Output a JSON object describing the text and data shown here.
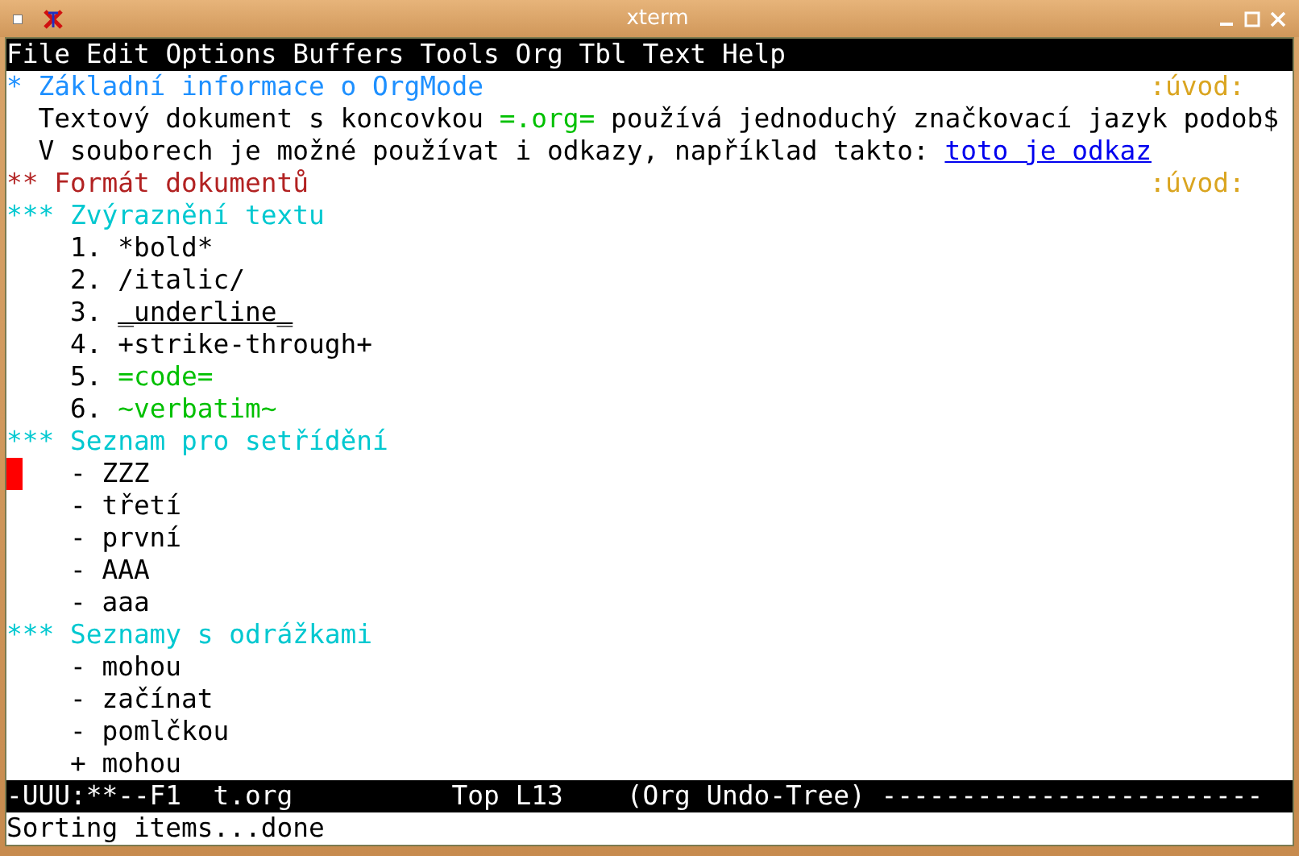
{
  "window": {
    "title": "xterm"
  },
  "menu": [
    "File",
    "Edit",
    "Options",
    "Buffers",
    "Tools",
    "Org",
    "Tbl",
    "Text",
    "Help"
  ],
  "lines": [
    {
      "kind": "h1",
      "cursor": false,
      "parts": [
        {
          "kind": "plain",
          "text": "* Základní informace o OrgMode"
        }
      ],
      "tag": ":úvod:"
    },
    {
      "kind": "body",
      "cursor": false,
      "parts": [
        {
          "kind": "plain",
          "text": "Textový dokument s koncovkou"
        },
        {
          "kind": "code",
          "text": "=.org="
        },
        {
          "kind": "plain",
          "text": "používá jednoduchý značkovací jazyk podob$"
        }
      ]
    },
    {
      "kind": "body",
      "cursor": false,
      "parts": [
        {
          "kind": "plain",
          "text": "V souborech je možné používat i odkazy, například takto:"
        },
        {
          "kind": "link",
          "text": "toto je odkaz"
        }
      ]
    },
    {
      "kind": "h2",
      "cursor": false,
      "parts": [
        {
          "kind": "plain",
          "text": "** Formát dokumentů"
        }
      ],
      "tag": ":úvod:"
    },
    {
      "kind": "h3",
      "cursor": false,
      "parts": [
        {
          "kind": "plain",
          "text": "*** Zvýraznění textu"
        }
      ]
    },
    {
      "kind": "item",
      "cursor": false,
      "parts": [
        {
          "kind": "plain",
          "text": "1."
        },
        {
          "kind": "plain",
          "text": "*bold*"
        }
      ]
    },
    {
      "kind": "item",
      "cursor": false,
      "parts": [
        {
          "kind": "plain",
          "text": "2."
        },
        {
          "kind": "plain",
          "text": "/italic/"
        }
      ]
    },
    {
      "kind": "item",
      "cursor": false,
      "parts": [
        {
          "kind": "plain",
          "text": "3."
        },
        {
          "kind": "underline",
          "text": "_underline_"
        }
      ]
    },
    {
      "kind": "item",
      "cursor": false,
      "parts": [
        {
          "kind": "plain",
          "text": "4."
        },
        {
          "kind": "plain",
          "text": "+strike-through+"
        }
      ]
    },
    {
      "kind": "item",
      "cursor": false,
      "parts": [
        {
          "kind": "plain",
          "text": "5."
        },
        {
          "kind": "code",
          "text": "=code="
        }
      ]
    },
    {
      "kind": "item",
      "cursor": false,
      "parts": [
        {
          "kind": "plain",
          "text": "6."
        },
        {
          "kind": "code",
          "text": "~verbatim~"
        }
      ]
    },
    {
      "kind": "h3",
      "cursor": false,
      "parts": [
        {
          "kind": "plain",
          "text": "*** Seznam pro setřídění"
        }
      ]
    },
    {
      "kind": "item",
      "cursor": true,
      "parts": [
        {
          "kind": "plain",
          "text": "-"
        },
        {
          "kind": "plain",
          "text": "ZZZ"
        }
      ]
    },
    {
      "kind": "item",
      "cursor": false,
      "parts": [
        {
          "kind": "plain",
          "text": "-"
        },
        {
          "kind": "plain",
          "text": "třetí"
        }
      ]
    },
    {
      "kind": "item",
      "cursor": false,
      "parts": [
        {
          "kind": "plain",
          "text": "-"
        },
        {
          "kind": "plain",
          "text": "první"
        }
      ]
    },
    {
      "kind": "item",
      "cursor": false,
      "parts": [
        {
          "kind": "plain",
          "text": "-"
        },
        {
          "kind": "plain",
          "text": "AAA"
        }
      ]
    },
    {
      "kind": "item",
      "cursor": false,
      "parts": [
        {
          "kind": "plain",
          "text": "-"
        },
        {
          "kind": "plain",
          "text": "aaa"
        }
      ]
    },
    {
      "kind": "h3",
      "cursor": false,
      "parts": [
        {
          "kind": "plain",
          "text": "*** Seznamy s odrážkami"
        }
      ]
    },
    {
      "kind": "item",
      "cursor": false,
      "parts": [
        {
          "kind": "plain",
          "text": "-"
        },
        {
          "kind": "plain",
          "text": "mohou"
        }
      ]
    },
    {
      "kind": "item",
      "cursor": false,
      "parts": [
        {
          "kind": "plain",
          "text": "-"
        },
        {
          "kind": "plain",
          "text": "začínat"
        }
      ]
    },
    {
      "kind": "item",
      "cursor": false,
      "parts": [
        {
          "kind": "plain",
          "text": "-"
        },
        {
          "kind": "plain",
          "text": "pomlčkou"
        }
      ]
    },
    {
      "kind": "item",
      "cursor": false,
      "parts": [
        {
          "kind": "plain",
          "text": "+"
        },
        {
          "kind": "plain",
          "text": "mohou"
        }
      ]
    }
  ],
  "mode_line": "-UUU:**--F1  t.org          Top L13    (Org Undo-Tree) ------------------------",
  "minibuffer": "Sorting items...done"
}
